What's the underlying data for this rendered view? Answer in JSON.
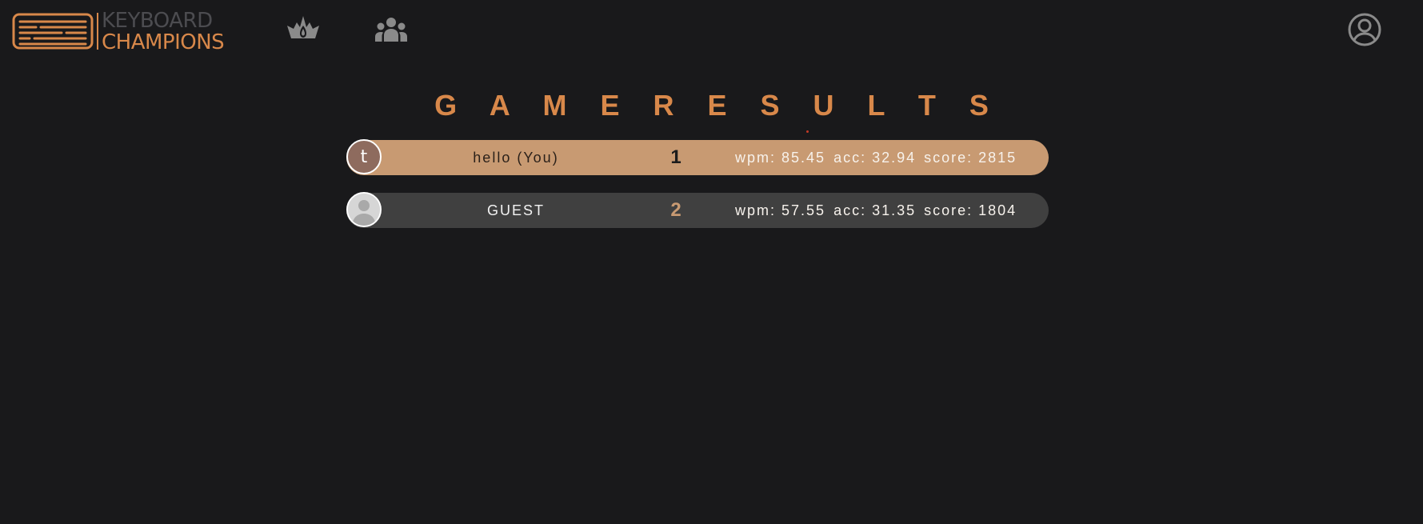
{
  "brand": {
    "line1": "KEYBOARD",
    "line2": "CHAMPIONS",
    "logo_icon": "keyboard-logo-icon",
    "accent_color": "#d8884a"
  },
  "nav": {
    "icons": [
      "crown-icon",
      "team-icon",
      "account-circle-icon"
    ]
  },
  "results": {
    "title": "G A M E R E S U L T S",
    "rows": [
      {
        "avatar_letter": "t",
        "name": "hello (You)",
        "place": "1",
        "wpm": "wpm: 85.45",
        "acc": "acc: 32.94",
        "score": "score: 2815",
        "background": "#c89a72"
      },
      {
        "avatar_icon": "guest-avatar-icon",
        "name": "GUEST",
        "place": "2",
        "wpm": "wpm: 57.55",
        "acc": "acc: 31.35",
        "score": "score: 1804",
        "background": "#404040"
      }
    ]
  }
}
